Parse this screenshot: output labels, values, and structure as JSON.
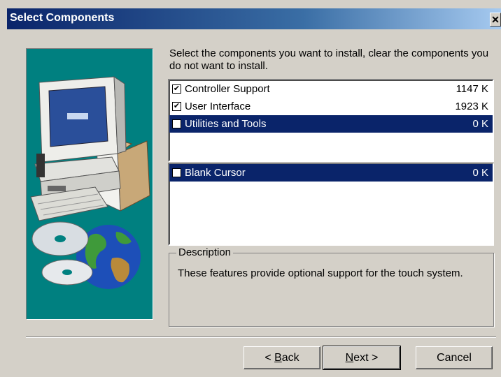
{
  "window": {
    "title": "Select Components",
    "close_glyph": "✕"
  },
  "instructions": "Select the components you want to install, clear the components you do not want to install.",
  "components": [
    {
      "label": "Controller Support",
      "size": "1147 K",
      "checked": true,
      "selected": false
    },
    {
      "label": "User Interface",
      "size": "1923 K",
      "checked": true,
      "selected": false
    },
    {
      "label": "Utilities and Tools",
      "size": "0 K",
      "checked": false,
      "selected": true
    }
  ],
  "subcomponents": [
    {
      "label": "Blank Cursor",
      "size": "0 K",
      "checked": false,
      "selected": true
    }
  ],
  "description": {
    "legend": "Description",
    "text": "These features provide optional support for the touch system."
  },
  "buttons": {
    "back_prefix": "< ",
    "back_mnemonic": "B",
    "back_rest": "ack",
    "next_mnemonic": "N",
    "next_rest": "ext >",
    "cancel": "Cancel"
  },
  "icons": {
    "computer": "computer-icon",
    "globe": "globe-icon",
    "cd": "cd-disc-icon",
    "check": "✔"
  },
  "colors": {
    "title_gradient_start": "#0a246a",
    "title_gradient_end": "#a6caf0",
    "art_background": "#008080",
    "selection": "#0a246a"
  }
}
